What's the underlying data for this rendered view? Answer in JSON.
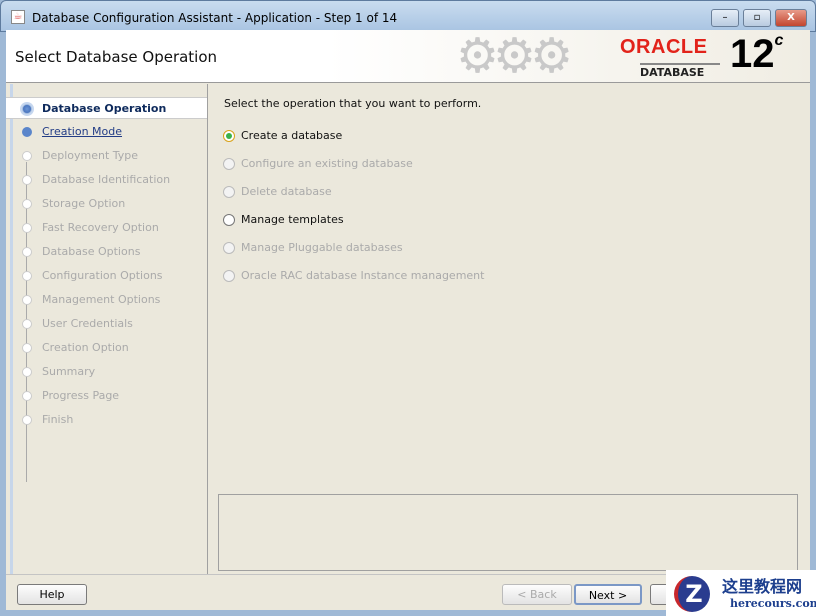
{
  "window": {
    "title": "Database Configuration Assistant - Application - Step 1 of 14",
    "minimize": "–",
    "maximize": "▫",
    "close": "X"
  },
  "header": {
    "title": "Select Database Operation",
    "brand": "ORACLE",
    "product": "DATABASE",
    "version": "12",
    "version_sup": "c"
  },
  "steps": [
    {
      "label": "Database Operation",
      "state": "current"
    },
    {
      "label": "Creation Mode",
      "state": "link"
    },
    {
      "label": "Deployment Type",
      "state": "disabled"
    },
    {
      "label": "Database Identification",
      "state": "disabled"
    },
    {
      "label": "Storage Option",
      "state": "disabled"
    },
    {
      "label": "Fast Recovery Option",
      "state": "disabled"
    },
    {
      "label": "Database Options",
      "state": "disabled"
    },
    {
      "label": "Configuration Options",
      "state": "disabled"
    },
    {
      "label": "Management Options",
      "state": "disabled"
    },
    {
      "label": "User Credentials",
      "state": "disabled"
    },
    {
      "label": "Creation Option",
      "state": "disabled"
    },
    {
      "label": "Summary",
      "state": "disabled"
    },
    {
      "label": "Progress Page",
      "state": "disabled"
    },
    {
      "label": "Finish",
      "state": "disabled"
    }
  ],
  "content": {
    "prompt": "Select the operation that you want to perform.",
    "options": [
      {
        "label": "Create a database",
        "selected": true,
        "enabled": true
      },
      {
        "label": "Configure an existing database",
        "selected": false,
        "enabled": false
      },
      {
        "label": "Delete database",
        "selected": false,
        "enabled": false
      },
      {
        "label": "Manage templates",
        "selected": false,
        "enabled": true
      },
      {
        "label": "Manage Pluggable databases",
        "selected": false,
        "enabled": false
      },
      {
        "label": "Oracle RAC database Instance management",
        "selected": false,
        "enabled": false
      }
    ]
  },
  "footer": {
    "help": "Help",
    "back": "< Back",
    "next": "Next >"
  },
  "watermark": {
    "cn": "这里教程网",
    "en": "herecours.com",
    "logo": "Z"
  }
}
